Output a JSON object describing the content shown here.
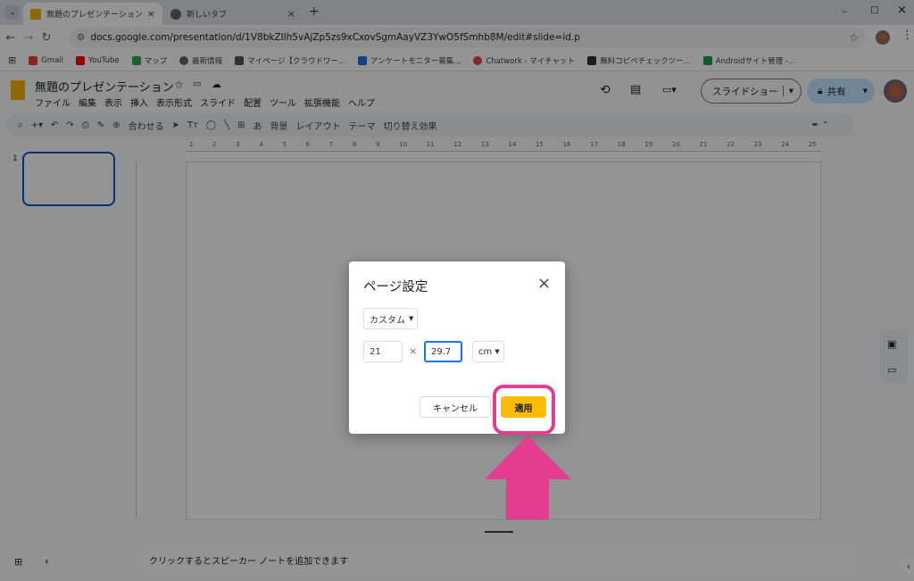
{
  "browser": {
    "tabs": [
      {
        "title": "無題のプレゼンテーション - Google",
        "close": "×"
      },
      {
        "title": "新しいタブ",
        "close": "×"
      }
    ],
    "new_tab": "+",
    "window_controls": [
      "–",
      "□",
      "×"
    ],
    "url": "docs.google.com/presentation/d/1V8bkZIlh5vAjZp5zs9xCxovSgmAayVZ3YwO5fSmhb8M/edit#slide=id.p",
    "bookmarks": [
      "Gmail",
      "YouTube",
      "マップ",
      "最新情報",
      "マイページ【クラウドワー...",
      "アンケートモニター募集...",
      "Chatwork - マイチャット",
      "無料コピペチェックツー...",
      "Androidサイト管理 -..."
    ]
  },
  "app": {
    "doc_title": "無題のプレゼンテーション",
    "menu": [
      "ファイル",
      "編集",
      "表示",
      "挿入",
      "表示形式",
      "スライド",
      "配置",
      "ツール",
      "拡張機能",
      "ヘルプ"
    ],
    "slideshow_label": "スライドショー",
    "share_label": "共有",
    "toolbar_zoom": "合わせる",
    "toolbar_items": [
      "背景",
      "レイアウト",
      "テーマ",
      "切り替え効果"
    ],
    "slide_number": "1",
    "ruler_labels": [
      "1",
      "2",
      "3",
      "4",
      "5",
      "6",
      "7",
      "8",
      "9",
      "10",
      "11",
      "12",
      "13",
      "14",
      "15",
      "16",
      "17",
      "18",
      "19",
      "20",
      "21",
      "22",
      "23",
      "24",
      "25"
    ],
    "speaker_notes": "クリックするとスピーカー ノートを追加できます"
  },
  "dialog": {
    "title": "ページ設定",
    "close": "×",
    "preset": "カスタム",
    "width": "21",
    "times": "×",
    "height": "29.7",
    "unit": "cm",
    "cancel": "キャンセル",
    "apply": "適用"
  },
  "colors": {
    "highlight": "#e23d8f",
    "apply_button": "#fbbc04",
    "slides_icon": "#f4b400"
  }
}
